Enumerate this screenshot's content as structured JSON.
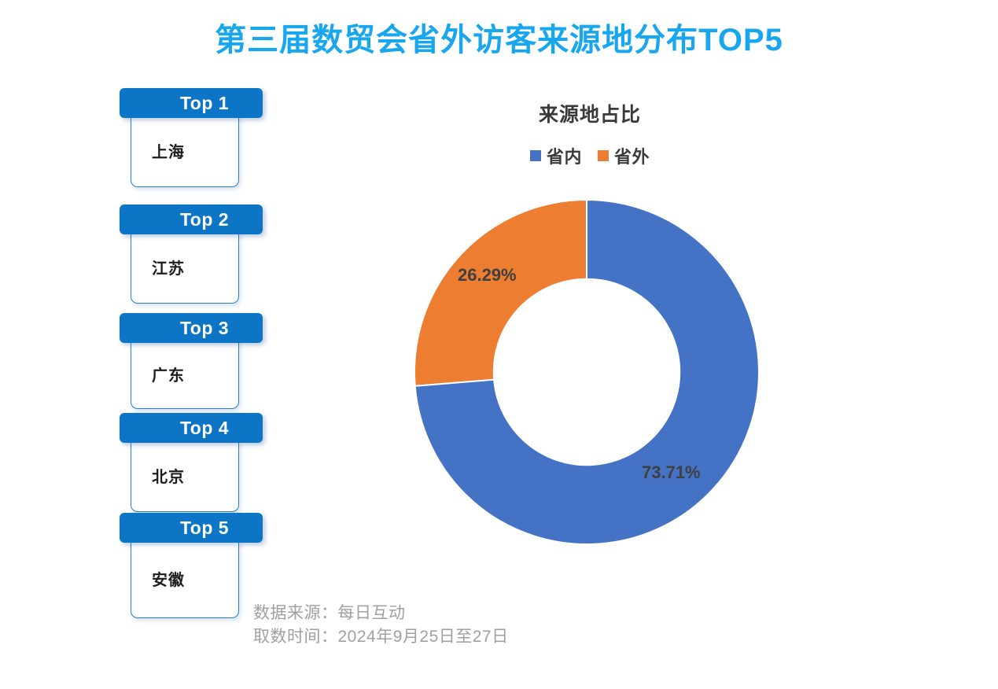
{
  "title": "第三届数贸会省外访客来源地分布TOP5",
  "title_color": "#18a6ef",
  "ranking": {
    "items": [
      {
        "rank_label": "Top 1",
        "city": "上海"
      },
      {
        "rank_label": "Top 2",
        "city": "江苏"
      },
      {
        "rank_label": "Top 3",
        "city": "广东"
      },
      {
        "rank_label": "Top 4",
        "city": "北京"
      },
      {
        "rank_label": "Top 5",
        "city": "安徽"
      }
    ],
    "bar_color": "#0c75c6",
    "card_border_color": "#2080d0"
  },
  "chart_data": {
    "type": "pie",
    "title": "来源地占比",
    "subtitle": "",
    "xlabel": "",
    "ylabel": "",
    "donut": true,
    "inner_radius_ratio": 0.54,
    "start_angle_deg": 0,
    "direction": "clockwise",
    "legend_position": "top",
    "grid": false,
    "categories": [
      "省内",
      "省外"
    ],
    "values": [
      73.71,
      26.29
    ],
    "labels": [
      "73.71%",
      "26.29%"
    ],
    "colors": [
      "#4472c4",
      "#ed7d31"
    ],
    "slices": [
      {
        "name": "省内",
        "value": 73.71,
        "label": "73.71%",
        "color": "#4472c4"
      },
      {
        "name": "省外",
        "value": 26.29,
        "label": "26.29%",
        "color": "#ed7d31"
      }
    ]
  },
  "footnotes": {
    "source": "数据来源：每日互动",
    "period": "取数时间：2024年9月25日至27日"
  }
}
